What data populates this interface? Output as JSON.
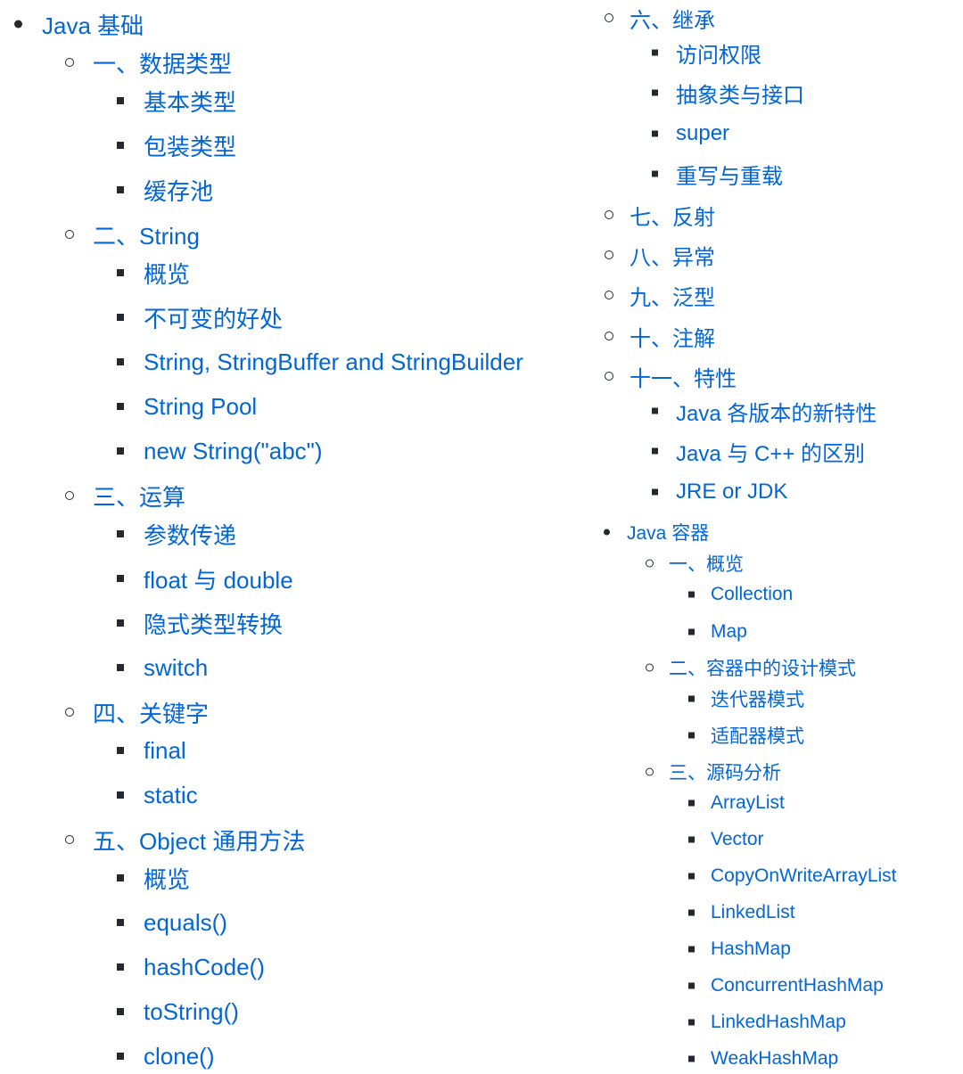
{
  "toc": {
    "link_color": "#0366d6",
    "bullet_color": "#24292e",
    "left_column": [
      {
        "level": 1,
        "label": "Java 基础"
      },
      {
        "level": 2,
        "label": "一、数据类型"
      },
      {
        "level": 3,
        "label": "基本类型"
      },
      {
        "level": 3,
        "label": "包装类型"
      },
      {
        "level": 3,
        "label": "缓存池"
      },
      {
        "level": 2,
        "label": "二、String"
      },
      {
        "level": 3,
        "label": "概览"
      },
      {
        "level": 3,
        "label": "不可变的好处"
      },
      {
        "level": 3,
        "label": "String, StringBuffer and StringBuilder"
      },
      {
        "level": 3,
        "label": "String Pool"
      },
      {
        "level": 3,
        "label": "new String(\"abc\")"
      },
      {
        "level": 2,
        "label": "三、运算"
      },
      {
        "level": 3,
        "label": "参数传递"
      },
      {
        "level": 3,
        "label": "float 与 double"
      },
      {
        "level": 3,
        "label": "隐式类型转换"
      },
      {
        "level": 3,
        "label": "switch"
      },
      {
        "level": 2,
        "label": "四、关键字"
      },
      {
        "level": 3,
        "label": "final"
      },
      {
        "level": 3,
        "label": "static"
      },
      {
        "level": 2,
        "label": "五、Object 通用方法"
      },
      {
        "level": 3,
        "label": "概览"
      },
      {
        "level": 3,
        "label": "equals()"
      },
      {
        "level": 3,
        "label": "hashCode()"
      },
      {
        "level": 3,
        "label": "toString()"
      },
      {
        "level": 3,
        "label": "clone()"
      }
    ],
    "right_column_top": [
      {
        "level": 2,
        "label": "六、继承"
      },
      {
        "level": 3,
        "label": "访问权限"
      },
      {
        "level": 3,
        "label": "抽象类与接口"
      },
      {
        "level": 3,
        "label": "super"
      },
      {
        "level": 3,
        "label": "重写与重载"
      },
      {
        "level": 2,
        "label": "七、反射"
      },
      {
        "level": 2,
        "label": "八、异常"
      },
      {
        "level": 2,
        "label": "九、泛型"
      },
      {
        "level": 2,
        "label": "十、注解"
      },
      {
        "level": 2,
        "label": "十一、特性"
      },
      {
        "level": 3,
        "label": "Java 各版本的新特性"
      },
      {
        "level": 3,
        "label": "Java 与 C++ 的区别"
      },
      {
        "level": 3,
        "label": "JRE or JDK"
      }
    ],
    "right_column_bottom": [
      {
        "level": 1,
        "label": "Java 容器"
      },
      {
        "level": 2,
        "label": "一、概览"
      },
      {
        "level": 3,
        "label": "Collection"
      },
      {
        "level": 3,
        "label": "Map"
      },
      {
        "level": 2,
        "label": "二、容器中的设计模式"
      },
      {
        "level": 3,
        "label": "迭代器模式"
      },
      {
        "level": 3,
        "label": "适配器模式"
      },
      {
        "level": 2,
        "label": "三、源码分析"
      },
      {
        "level": 3,
        "label": "ArrayList"
      },
      {
        "level": 3,
        "label": "Vector"
      },
      {
        "level": 3,
        "label": "CopyOnWriteArrayList"
      },
      {
        "level": 3,
        "label": "LinkedList"
      },
      {
        "level": 3,
        "label": "HashMap"
      },
      {
        "level": 3,
        "label": "ConcurrentHashMap"
      },
      {
        "level": 3,
        "label": "LinkedHashMap"
      },
      {
        "level": 3,
        "label": "WeakHashMap"
      }
    ]
  }
}
